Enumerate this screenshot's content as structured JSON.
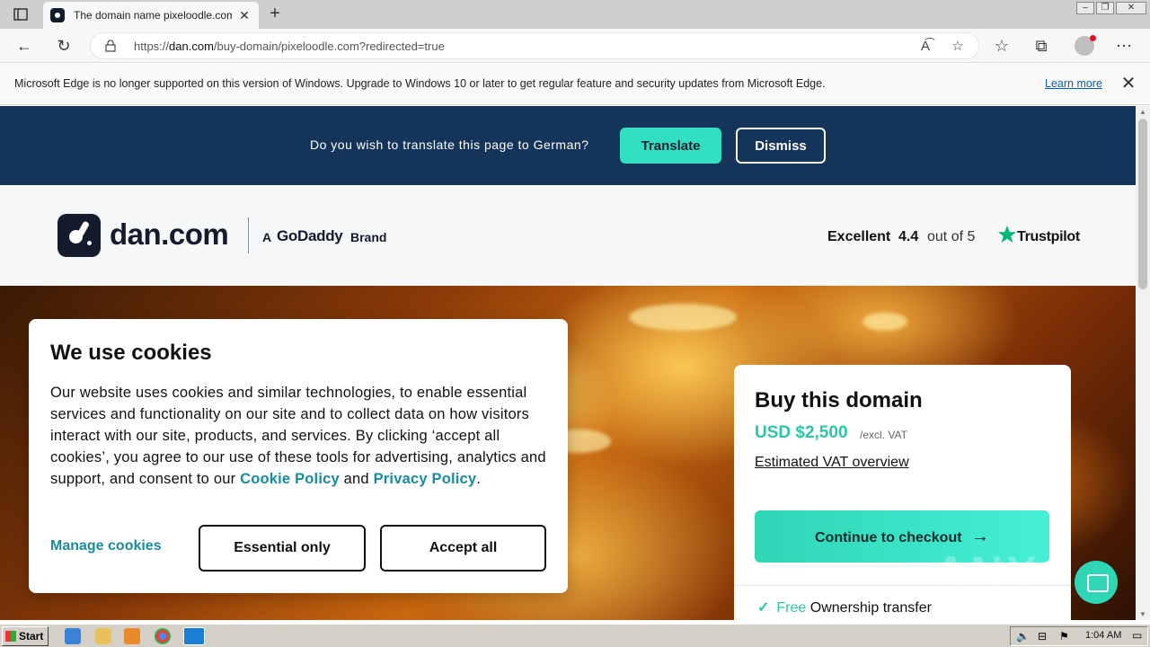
{
  "browser": {
    "tab_title": "The domain name pixeloodle.com",
    "url_prefix": "https://",
    "url_host": "dan.com",
    "url_path": "/buy-domain/pixeloodle.com?redirected=true"
  },
  "edge_notice": {
    "text": "Microsoft Edge is no longer supported on this version of Windows. Upgrade to Windows 10 or later to get regular feature and security updates from Microsoft Edge.",
    "link": "Learn more"
  },
  "translate_bar": {
    "question": "Do you wish to translate this page to German?",
    "translate_label": "Translate",
    "dismiss_label": "Dismiss"
  },
  "header": {
    "logo_text": "dan.com",
    "brand_prefix": "A",
    "brand_name": "GoDaddy",
    "brand_suffix": "Brand",
    "rating_word": "Excellent",
    "rating_score": "4.4",
    "rating_outof": "out of 5",
    "trustpilot": "Trustpilot"
  },
  "cookie": {
    "title": "We use cookies",
    "body_1": "Our website uses cookies and similar technologies, to enable essential services and functionality on our site and to collect data on how visitors interact with our site, products, and services. By clicking ‘accept all cookies’, you agree to our use of these tools for advertising, analytics and support, and consent to our ",
    "cookie_policy": "Cookie Policy",
    "body_2": " and ",
    "privacy_policy": "Privacy Policy",
    "body_3": ".",
    "manage_label": "Manage cookies",
    "essential_label": "Essential only",
    "accept_label": "Accept all"
  },
  "buy": {
    "title": "Buy this domain",
    "price": "USD $2,500",
    "vat_note": "/excl. VAT",
    "vat_link": "Estimated VAT overview",
    "checkout_label": "Continue to checkout",
    "feature_free": "Free",
    "feature_rest": "Ownership transfer"
  },
  "watermark": "ANY RUN",
  "taskbar": {
    "start_label": "Start",
    "clock": "1:04 AM"
  },
  "colors": {
    "translate_bar": "#15345a",
    "accent": "#31e0c0",
    "link": "#1a8a9e"
  }
}
